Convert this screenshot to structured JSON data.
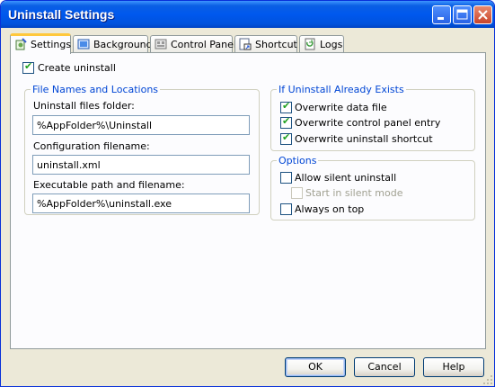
{
  "window": {
    "title": "Uninstall Settings"
  },
  "tabs": [
    {
      "label": "Settings",
      "icon": "settings-icon",
      "active": true
    },
    {
      "label": "Background",
      "icon": "background-icon",
      "active": false
    },
    {
      "label": "Control Panel",
      "icon": "control-panel-icon",
      "active": false
    },
    {
      "label": "Shortcut",
      "icon": "shortcut-icon",
      "active": false
    },
    {
      "label": "Logs",
      "icon": "logs-icon",
      "active": false
    }
  ],
  "settings": {
    "create_uninstall": {
      "label": "Create uninstall",
      "checked": true
    },
    "file_names_group": {
      "title": "File Names and Locations",
      "uninstall_folder_label": "Uninstall files folder:",
      "uninstall_folder_value": "%AppFolder%\\Uninstall",
      "config_label": "Configuration filename:",
      "config_value": "uninstall.xml",
      "exe_label": "Executable path and filename:",
      "exe_value": "%AppFolder%\\uninstall.exe"
    },
    "exists_group": {
      "title": "If Uninstall Already Exists",
      "overwrite_data": {
        "label": "Overwrite data file",
        "checked": true
      },
      "overwrite_cp": {
        "label": "Overwrite control panel entry",
        "checked": true
      },
      "overwrite_shortcut": {
        "label": "Overwrite uninstall shortcut",
        "checked": true
      }
    },
    "options_group": {
      "title": "Options",
      "allow_silent": {
        "label": "Allow silent uninstall",
        "checked": false
      },
      "start_silent": {
        "label": "Start in silent mode",
        "checked": false,
        "disabled": true
      },
      "always_on_top": {
        "label": "Always on top",
        "checked": false
      }
    }
  },
  "buttons": {
    "ok": "OK",
    "cancel": "Cancel",
    "help": "Help"
  },
  "colors": {
    "title_bar": "#0058ee",
    "group_title": "#0046d5",
    "tab_highlight": "#ffc83c",
    "dialog_bg": "#ece9d8"
  }
}
